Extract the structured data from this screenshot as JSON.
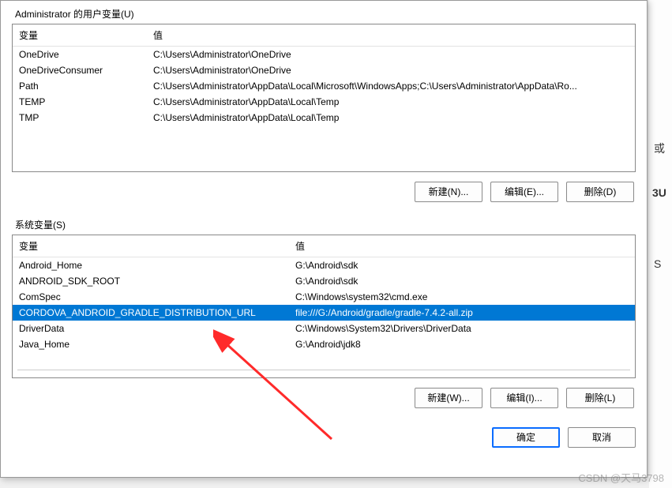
{
  "dialog": {
    "user_section_label": "Administrator 的用户变量(U)",
    "system_section_label": "系统变量(S)",
    "col_variable": "变量",
    "col_value": "值",
    "buttons_user": {
      "new": "新建(N)...",
      "edit": "编辑(E)...",
      "delete": "删除(D)"
    },
    "buttons_system": {
      "new": "新建(W)...",
      "edit": "编辑(I)...",
      "delete": "删除(L)"
    },
    "footer": {
      "ok": "确定",
      "cancel": "取消"
    }
  },
  "user_vars": [
    {
      "name": "OneDrive",
      "value": "C:\\Users\\Administrator\\OneDrive"
    },
    {
      "name": "OneDriveConsumer",
      "value": "C:\\Users\\Administrator\\OneDrive"
    },
    {
      "name": "Path",
      "value": "C:\\Users\\Administrator\\AppData\\Local\\Microsoft\\WindowsApps;C:\\Users\\Administrator\\AppData\\Ro..."
    },
    {
      "name": "TEMP",
      "value": "C:\\Users\\Administrator\\AppData\\Local\\Temp"
    },
    {
      "name": "TMP",
      "value": "C:\\Users\\Administrator\\AppData\\Local\\Temp"
    }
  ],
  "system_vars": [
    {
      "name": "Android_Home",
      "value": "G:\\Android\\sdk",
      "selected": false
    },
    {
      "name": "ANDROID_SDK_ROOT",
      "value": "G:\\Android\\sdk",
      "selected": false
    },
    {
      "name": "ComSpec",
      "value": "C:\\Windows\\system32\\cmd.exe",
      "selected": false
    },
    {
      "name": "CORDOVA_ANDROID_GRADLE_DISTRIBUTION_URL",
      "value": "file:///G:/Android/gradle/gradle-7.4.2-all.zip",
      "selected": true
    },
    {
      "name": "DriverData",
      "value": "C:\\Windows\\System32\\Drivers\\DriverData",
      "selected": false
    },
    {
      "name": "Java_Home",
      "value": "G:\\Android\\jdk8",
      "selected": false
    }
  ],
  "watermark": "CSDN @天马3798",
  "bg_fragments": {
    "a": "或",
    "b": "S",
    "c": "3U"
  }
}
